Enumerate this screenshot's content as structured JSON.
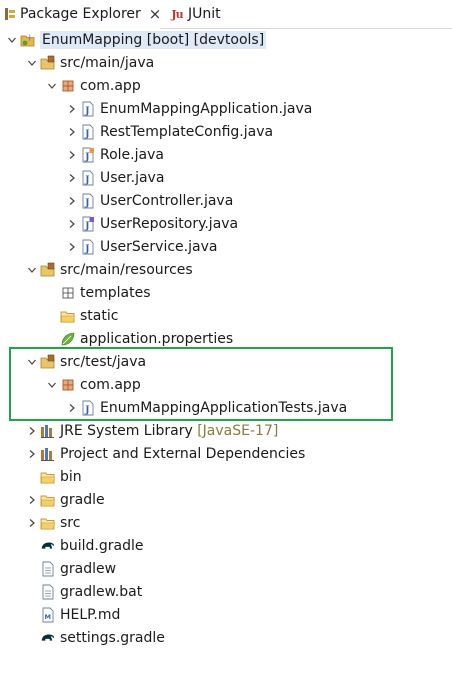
{
  "tabs": [
    {
      "label": "Package Explorer",
      "icon": "package-explorer-icon",
      "active": true
    },
    {
      "label": "JUnit",
      "icon": "junit-icon",
      "active": false
    }
  ],
  "tab_close": "×",
  "colors": {
    "highlight_border": "#23a348",
    "selection_bg": "#dfe9f7",
    "decoration": "#8a7a3c"
  },
  "tree": [
    {
      "label": "EnumMapping [boot] [devtools]",
      "icon": "project-icon",
      "expanded": true
    },
    {
      "label": "src/main/java",
      "icon": "source-folder-icon",
      "expanded": true
    },
    {
      "label": "com.app",
      "icon": "package-icon",
      "expanded": true
    },
    {
      "label": "EnumMappingApplication.java",
      "icon": "java-file-icon",
      "expanded": false
    },
    {
      "label": "RestTemplateConfig.java",
      "icon": "java-file-icon",
      "expanded": false
    },
    {
      "label": "Role.java",
      "icon": "java-enum-file-icon",
      "expanded": false
    },
    {
      "label": "User.java",
      "icon": "java-file-icon",
      "expanded": false
    },
    {
      "label": "UserController.java",
      "icon": "java-file-icon",
      "expanded": false
    },
    {
      "label": "UserRepository.java",
      "icon": "java-interface-file-icon",
      "expanded": false
    },
    {
      "label": "UserService.java",
      "icon": "java-file-icon",
      "expanded": false
    },
    {
      "label": "src/main/resources",
      "icon": "source-folder-icon",
      "expanded": true
    },
    {
      "label": "templates",
      "icon": "empty-package-icon"
    },
    {
      "label": "static",
      "icon": "folder-icon"
    },
    {
      "label": "application.properties",
      "icon": "properties-leaf-icon"
    },
    {
      "label": "src/test/java",
      "icon": "source-folder-icon",
      "expanded": true
    },
    {
      "label": "com.app",
      "icon": "package-icon",
      "expanded": true
    },
    {
      "label": "EnumMappingApplicationTests.java",
      "icon": "java-file-icon",
      "expanded": false
    },
    {
      "label": "JRE System Library",
      "decoration": "[JavaSE-17]",
      "icon": "library-icon",
      "expanded": false
    },
    {
      "label": "Project and External Dependencies",
      "icon": "library-icon",
      "expanded": false
    },
    {
      "label": "bin",
      "icon": "folder-icon"
    },
    {
      "label": "gradle",
      "icon": "folder-icon",
      "expanded": false
    },
    {
      "label": "src",
      "icon": "folder-icon",
      "expanded": false
    },
    {
      "label": "build.gradle",
      "icon": "gradle-elephant-icon"
    },
    {
      "label": "gradlew",
      "icon": "text-file-icon"
    },
    {
      "label": "gradlew.bat",
      "icon": "text-file-icon"
    },
    {
      "label": "HELP.md",
      "icon": "markdown-file-icon"
    },
    {
      "label": "settings.gradle",
      "icon": "gradle-elephant-icon"
    }
  ]
}
